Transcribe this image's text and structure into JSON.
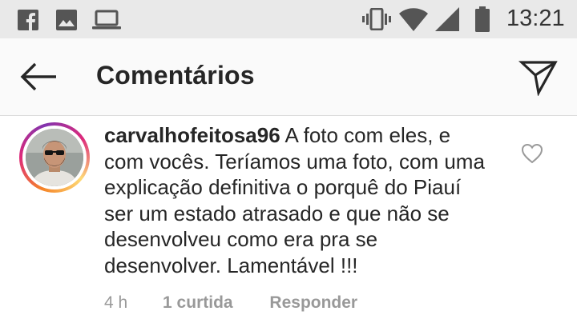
{
  "status_bar": {
    "time": "13:21",
    "left_icons": [
      "facebook-icon",
      "image-icon",
      "laptop-icon"
    ],
    "right_icons": [
      "vibrate-icon",
      "wifi-icon",
      "signal-icon",
      "battery-icon"
    ]
  },
  "header": {
    "title": "Comentários",
    "back_icon": "arrow-left-icon",
    "send_icon": "send-icon"
  },
  "comment": {
    "username": "carvalhofeitosa96",
    "text": " A foto com eles, e com vocês. Teríamos uma foto, com uma explicação definitiva o porquê do Piauí ser um estado atrasado e que não se desenvolveu como era pra se desenvolver. Lamentável !!!",
    "time": "4 h",
    "likes": "1 curtida",
    "reply_label": "Responder",
    "like_icon": "heart-outline-icon"
  },
  "colors": {
    "status_bar_bg": "#e9e9e9",
    "header_bg": "#fafafa",
    "text_primary": "#262626",
    "text_secondary": "#999999"
  }
}
